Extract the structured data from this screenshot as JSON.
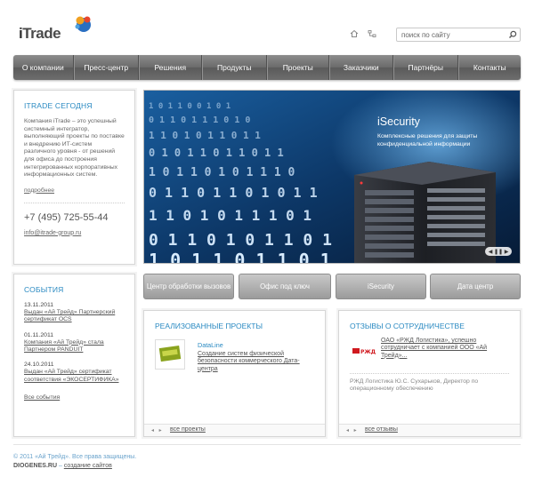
{
  "header": {
    "logo_text_i": "i",
    "logo_text_rest": "Trade",
    "search_placeholder": "поиск по сайту"
  },
  "nav": {
    "items": [
      "О компании",
      "Пресс-центр",
      "Решения",
      "Продукты",
      "Проекты",
      "Заказчики",
      "Партнёры",
      "Контакты"
    ]
  },
  "about": {
    "title": "ITRADE СЕГОДНЯ",
    "text": "Компания iTrade – это успешный системный интегратор, выполняющий проекты по поставке и внедрению ИТ-систем различного уровня - от решений для офиса до построения интегрированных корпоративных информационных систем.",
    "more": "подробнее",
    "phone": "+7 (495) 725-55-44",
    "email": "info@itrade-group.ru"
  },
  "banner": {
    "title": "iSecurity",
    "subtitle": "Комплексные решения для защиты конфиденциальной информации",
    "controls": "◀ ❚❚ ▶"
  },
  "events": {
    "title": "СОБЫТИЯ",
    "items": [
      {
        "date": "13.11.2011",
        "text": "Выдан «Ай Трейд» Партнерский сертификат OCS"
      },
      {
        "date": "01.11.2011",
        "text": "Компания «Ай Трейд» стала Партнером PANDUIT"
      },
      {
        "date": "24.10.2011",
        "text": "Выдан «Ай Трейд» сертификат соответствия «ЭКОСЕРТИФИКА»"
      }
    ],
    "all": "Все события"
  },
  "buttons": [
    "Центр обработки вызовов",
    "Офис под ключ",
    "iSecurity",
    "Дата центр"
  ],
  "projects": {
    "title": "РЕАЛИЗОВАННЫЕ ПРОЕКТЫ",
    "name": "DataLine",
    "desc": "Создание систем физической безопасности коммерческого Дата-центра",
    "all": "все проекты"
  },
  "reviews": {
    "title": "ОТЗЫВЫ О СОТРУДНИЧЕСТВЕ",
    "text": "ОАО «РЖД Логистика», успешно сотрудничает с компанией ООО «Ай Трейд»...",
    "author": "РЖД Логистика Ю.С. Сухарьков, Директор по операционному обеспечению",
    "all": "все отзывы"
  },
  "footer": {
    "copyright": "© 2011 «Ай Трейд». Все права защищены.",
    "diogenes": "DIOGENES.RU",
    "dash": " – ",
    "create": "создание сайтов"
  },
  "colors": {
    "accent": "#2a8ac2",
    "nav": "#6d6d6d",
    "button": "#a9a9a9"
  }
}
